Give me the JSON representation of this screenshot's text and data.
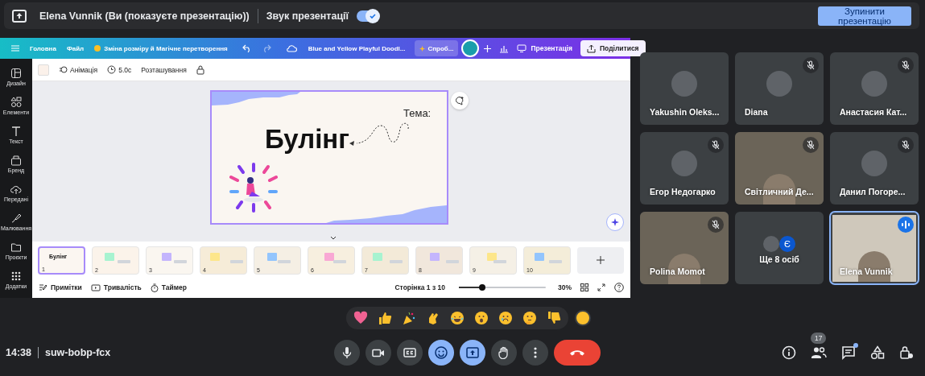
{
  "share_banner": {
    "presenter": "Elena Vunnik (Ви (показуєте презентацію))",
    "audio_label": "Звук презентації",
    "audio_on": true,
    "stop_button": "Зупинити презентацію"
  },
  "canva": {
    "menu": [
      "Головна",
      "Файл",
      "Зміна розміру й Магічне перетворення"
    ],
    "doc_title": "Blue and Yellow Playful Doodl...",
    "try_button": "Спроб...",
    "present_button": "Презентація",
    "share_button": "Поділитися",
    "toolbar": {
      "animation": "Анімація",
      "duration": "5.0с",
      "position": "Розташування"
    },
    "sidebar": [
      {
        "label": "Дизайн",
        "kind": "design"
      },
      {
        "label": "Елементи",
        "kind": "elements"
      },
      {
        "label": "Текст",
        "kind": "text"
      },
      {
        "label": "Бренд",
        "kind": "brand"
      },
      {
        "label": "Передані",
        "kind": "uploads"
      },
      {
        "label": "Малювання",
        "kind": "draw"
      },
      {
        "label": "Проєкти",
        "kind": "projects"
      },
      {
        "label": "Додатки",
        "kind": "apps"
      }
    ],
    "slide": {
      "topic": "Тема:",
      "title": "Булінг"
    },
    "thumbnails": [
      {
        "number": "1",
        "selected": true,
        "title": "Булінг"
      },
      {
        "number": "2",
        "selected": false
      },
      {
        "number": "3",
        "selected": false
      },
      {
        "number": "4",
        "selected": false
      },
      {
        "number": "5",
        "selected": false
      },
      {
        "number": "6",
        "selected": false
      },
      {
        "number": "7",
        "selected": false
      },
      {
        "number": "8",
        "selected": false
      },
      {
        "number": "9",
        "selected": false
      },
      {
        "number": "10",
        "selected": false
      }
    ],
    "footer": {
      "notes": "Примітки",
      "duration": "Тривалість",
      "timer": "Таймер",
      "page": "Сторінка 1 з 10",
      "zoom": {
        "level": 0.27
      },
      "zoom_reading": "30%"
    }
  },
  "participants": [
    {
      "name": "Yakushin Oleks...",
      "kind": "avatar",
      "muted": false,
      "speaking": false
    },
    {
      "name": "Diana",
      "kind": "avatar",
      "muted": true,
      "speaking": false
    },
    {
      "name": "Анастасия Кат...",
      "kind": "avatar",
      "muted": true,
      "speaking": false
    },
    {
      "name": "Егор Недогарко",
      "kind": "avatar",
      "muted": true,
      "speaking": false
    },
    {
      "name": "Світличний Де...",
      "kind": "video",
      "muted": true,
      "speaking": false
    },
    {
      "name": "Данил Погоре...",
      "kind": "avatar",
      "muted": true,
      "speaking": false
    },
    {
      "name": "Polina Momot",
      "kind": "video",
      "muted": true,
      "speaking": false
    },
    {
      "name": "Ще 8 осіб",
      "kind": "more",
      "muted": false,
      "speaking": false,
      "initial": "Є"
    },
    {
      "name": "Elena Vunnik",
      "kind": "video",
      "muted": false,
      "speaking": true
    }
  ],
  "reactions": [
    {
      "kind": "heart"
    },
    {
      "kind": "thumbs_up"
    },
    {
      "kind": "party"
    },
    {
      "kind": "clap"
    },
    {
      "kind": "laugh"
    },
    {
      "kind": "surprised"
    },
    {
      "kind": "sad"
    },
    {
      "kind": "thinking"
    },
    {
      "kind": "thumbs_down"
    }
  ],
  "call": {
    "time": "14:38",
    "code": "suw-bobp-fcx",
    "participant_count": "17",
    "chat_unread": true
  }
}
